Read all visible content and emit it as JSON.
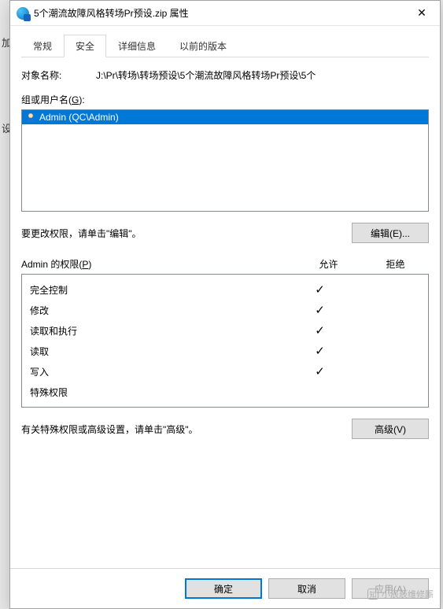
{
  "background": {
    "hint1": "加",
    "hint2": "设"
  },
  "titlebar": {
    "text": "5个潮流故障风格转场Pr预设.zip 属性",
    "close": "✕"
  },
  "tabs": [
    {
      "label": "常规",
      "active": false
    },
    {
      "label": "安全",
      "active": true
    },
    {
      "label": "详细信息",
      "active": false
    },
    {
      "label": "以前的版本",
      "active": false
    }
  ],
  "object": {
    "label": "对象名称:",
    "value": "J:\\Pr\\转场\\转场预设\\5个潮流故障风格转场Pr预设\\5个"
  },
  "groups": {
    "label_pre": "组或用户名(",
    "label_u": "G",
    "label_post": "):",
    "items": [
      {
        "text": "Admin (QC\\Admin)"
      }
    ]
  },
  "edit_hint": "要更改权限，请单击\"编辑\"。",
  "edit_btn": "编辑(E)...",
  "perm_title_pre": "Admin 的权限(",
  "perm_title_u": "P",
  "perm_title_post": ")",
  "perm_cols": {
    "allow": "允许",
    "deny": "拒绝"
  },
  "permissions": [
    {
      "name": "完全控制",
      "allow": true,
      "deny": false
    },
    {
      "name": "修改",
      "allow": true,
      "deny": false
    },
    {
      "name": "读取和执行",
      "allow": true,
      "deny": false
    },
    {
      "name": "读取",
      "allow": true,
      "deny": false
    },
    {
      "name": "写入",
      "allow": true,
      "deny": false
    },
    {
      "name": "特殊权限",
      "allow": false,
      "deny": false
    }
  ],
  "adv_hint": "有关特殊权限或高级设置，请单击\"高级\"。",
  "adv_btn": "高级(V)",
  "footer": {
    "ok": "确定",
    "cancel": "取消",
    "apply": "应用(A)"
  },
  "watermark": "小辰辰维修厮"
}
